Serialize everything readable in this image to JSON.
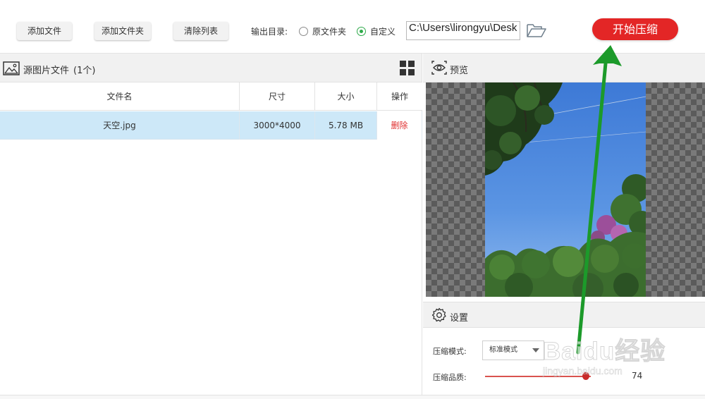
{
  "toolbar": {
    "add_file": "添加文件",
    "add_folder": "添加文件夹",
    "clear_list": "清除列表",
    "output_label": "输出目录:",
    "opt_original": "原文件夹",
    "opt_custom": "自定义",
    "selected_option": "自定义",
    "output_path": "C:\\Users\\lirongyu\\Desk",
    "start": "开始压缩",
    "start_color": "#e32626"
  },
  "source_panel": {
    "title": "源图片文件",
    "count": "(1个)",
    "columns": [
      "文件名",
      "尺寸",
      "大小",
      "操作"
    ],
    "rows": [
      {
        "name": "天空.jpg",
        "dimensions": "3000*4000",
        "size": "5.78 MB",
        "action": "删除"
      }
    ],
    "icons": [
      "image-icon",
      "grid-view-icon"
    ]
  },
  "preview_panel": {
    "title": "预览",
    "icon": "eye-icon"
  },
  "settings": {
    "title": "设置",
    "icon": "gear-icon",
    "mode_label": "压缩模式:",
    "mode_value": "标准模式",
    "quality_label": "压缩品质:",
    "quality_value": "74"
  },
  "watermark": {
    "text": "Baidu经验",
    "sub": "jingyan.baidu.com"
  },
  "annotation": {
    "color": "#1c9a2a"
  }
}
